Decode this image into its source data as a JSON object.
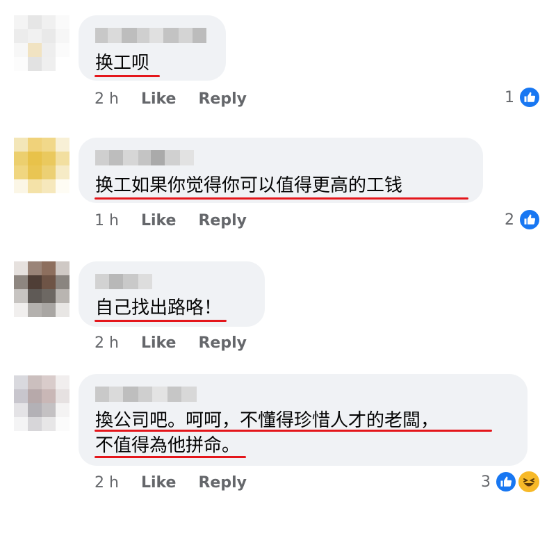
{
  "comments": [
    {
      "text_lines": [
        "换工呗"
      ],
      "time": "2 h",
      "like_label": "Like",
      "reply_label": "Reply",
      "reaction_count": "1",
      "reaction_icons": [
        "like-icon"
      ]
    },
    {
      "text_lines": [
        "换工如果你觉得你可以值得更高的工钱"
      ],
      "time": "1 h",
      "like_label": "Like",
      "reply_label": "Reply",
      "reaction_count": "2",
      "reaction_icons": [
        "like-icon"
      ]
    },
    {
      "text_lines": [
        "自己找出路咯！"
      ],
      "time": "2 h",
      "like_label": "Like",
      "reply_label": "Reply",
      "reaction_count": "",
      "reaction_icons": []
    },
    {
      "text_lines": [
        "換公司吧。呵呵，不懂得珍惜人才的老闆，",
        "不值得為他拼命。"
      ],
      "time": "2 h",
      "like_label": "Like",
      "reply_label": "Reply",
      "reaction_count": "3",
      "reaction_icons": [
        "like-icon",
        "haha-icon"
      ]
    }
  ],
  "colors": {
    "bubble": "#f0f2f5",
    "underline": "#e4161b",
    "like_blue": "#1877f2",
    "meta_gray": "#65676b"
  }
}
